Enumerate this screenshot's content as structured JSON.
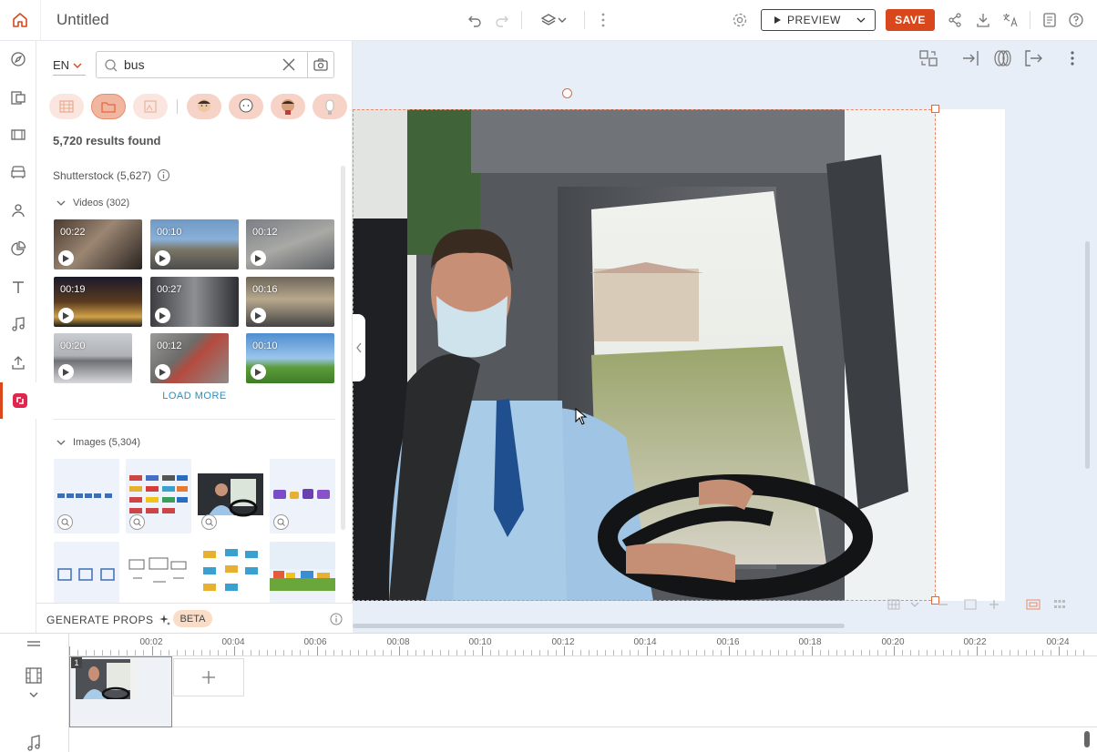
{
  "header": {
    "title": "Untitled",
    "preview_label": "PREVIEW",
    "save_label": "SAVE"
  },
  "panel": {
    "language": "EN",
    "search_value": "bus",
    "results_text": "5,720 results found",
    "source_label": "Shutterstock (5,627)",
    "videos_label": "Videos (302)",
    "videos": [
      {
        "duration": "00:22"
      },
      {
        "duration": "00:10"
      },
      {
        "duration": "00:12"
      },
      {
        "duration": "00:19"
      },
      {
        "duration": "00:27"
      },
      {
        "duration": "00:16"
      },
      {
        "duration": "00:20"
      },
      {
        "duration": "00:12"
      },
      {
        "duration": "00:10"
      }
    ],
    "load_more": "LOAD MORE",
    "images_label": "Images (5,304)",
    "generate_props": "GENERATE PROPS",
    "beta": "BETA"
  },
  "timeline": {
    "ticks": [
      "00:02",
      "00:04",
      "00:06",
      "00:08",
      "00:10",
      "00:12",
      "00:14",
      "00:16",
      "00:18",
      "00:20",
      "00:22",
      "00:24"
    ],
    "scene_number": "1"
  },
  "colors": {
    "accent": "#d9471c",
    "chip": "#f6d3c6",
    "link": "#2d8ec0"
  }
}
